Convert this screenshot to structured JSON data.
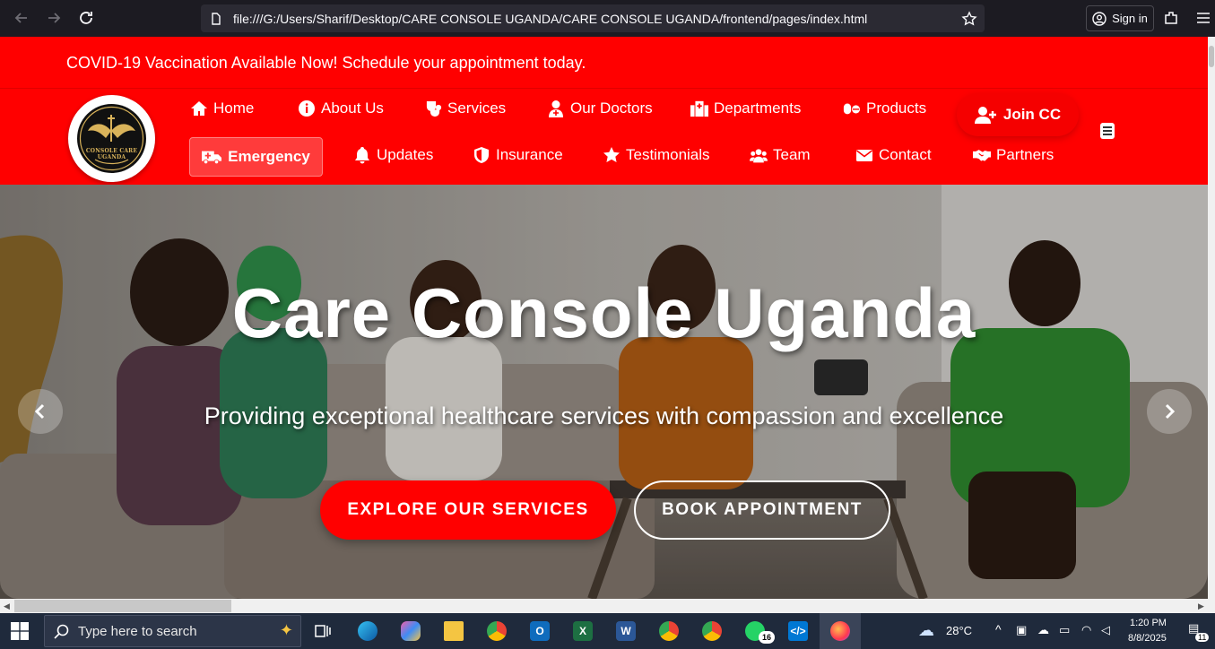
{
  "browser": {
    "url": "file:///G:/Users/Sharif/Desktop/CARE CONSOLE UGANDA/CARE CONSOLE UGANDA/frontend/pages/index.html",
    "sign_in_label": "Sign in"
  },
  "announcement": "COVID-19 Vaccination Available Now! Schedule your appointment today.",
  "logo": {
    "text": "CONSOLE CARE UGANDA"
  },
  "nav": {
    "row1": [
      {
        "label": "Home",
        "icon": "home-icon"
      },
      {
        "label": "About Us",
        "icon": "info-icon"
      },
      {
        "label": "Services",
        "icon": "stethoscope-icon"
      },
      {
        "label": "Our Doctors",
        "icon": "doctor-icon"
      },
      {
        "label": "Departments",
        "icon": "hospital-icon"
      },
      {
        "label": "Products",
        "icon": "pills-icon"
      }
    ],
    "join_label": "Join CC",
    "emergency_label": "Emergency",
    "row2": [
      {
        "label": "Updates",
        "icon": "bell-icon"
      },
      {
        "label": "Insurance",
        "icon": "shield-icon"
      },
      {
        "label": "Testimonials",
        "icon": "star-icon"
      },
      {
        "label": "Team",
        "icon": "users-icon"
      },
      {
        "label": "Contact",
        "icon": "envelope-icon"
      },
      {
        "label": "Partners",
        "icon": "handshake-icon"
      }
    ]
  },
  "hero": {
    "title": "Care Console Uganda",
    "subtitle": "Providing exceptional healthcare services with compassion and excellence",
    "primary_button": "EXPLORE OUR SERVICES",
    "secondary_button": "BOOK APPOINTMENT"
  },
  "taskbar": {
    "search_placeholder": "Type here to search",
    "whatsapp_badge": "16",
    "weather": "28°C",
    "time": "1:20 PM",
    "date": "8/8/2025",
    "notification_count": "11"
  },
  "colors": {
    "brand_red": "#ff0000",
    "chrome_bg": "#1c1b22",
    "taskbar_bg": "#1f2a3c"
  }
}
